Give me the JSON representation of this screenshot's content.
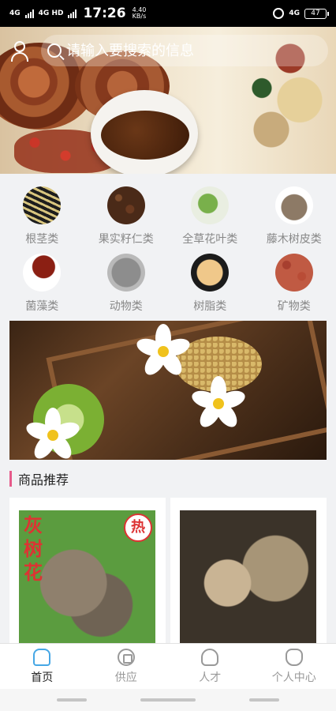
{
  "status_bar": {
    "network1": "4G",
    "network2": "4G HD",
    "time": "17:26",
    "speed_value": "4.40",
    "speed_unit": "KB/s",
    "network_right": "4G",
    "battery": "47",
    "icons": [
      "signal-icon",
      "alarm-icon",
      "battery-icon"
    ]
  },
  "header": {
    "search_placeholder": "请输入要搜索的信息",
    "user_icon": "user-icon",
    "search_icon": "search-icon"
  },
  "categories": [
    {
      "label": "根茎类"
    },
    {
      "label": "果实籽仁类"
    },
    {
      "label": "全草花叶类"
    },
    {
      "label": "藤木树皮类"
    },
    {
      "label": "菌藻类"
    },
    {
      "label": "动物类"
    },
    {
      "label": "树脂类"
    },
    {
      "label": "矿物类"
    }
  ],
  "section": {
    "title": "商品推荐",
    "accent_color": "#e65a8a"
  },
  "products": [
    {
      "overlay_text": "灰树花",
      "badge": "热"
    },
    {
      "overlay_text": "",
      "badge": ""
    }
  ],
  "tabbar": {
    "items": [
      {
        "label": "首页",
        "icon": "home-icon",
        "active": true
      },
      {
        "label": "供应",
        "icon": "supply-icon",
        "active": false
      },
      {
        "label": "人才",
        "icon": "talent-icon",
        "active": false
      },
      {
        "label": "个人中心",
        "icon": "profile-icon",
        "active": false
      }
    ],
    "active_color": "#46a7e5"
  }
}
